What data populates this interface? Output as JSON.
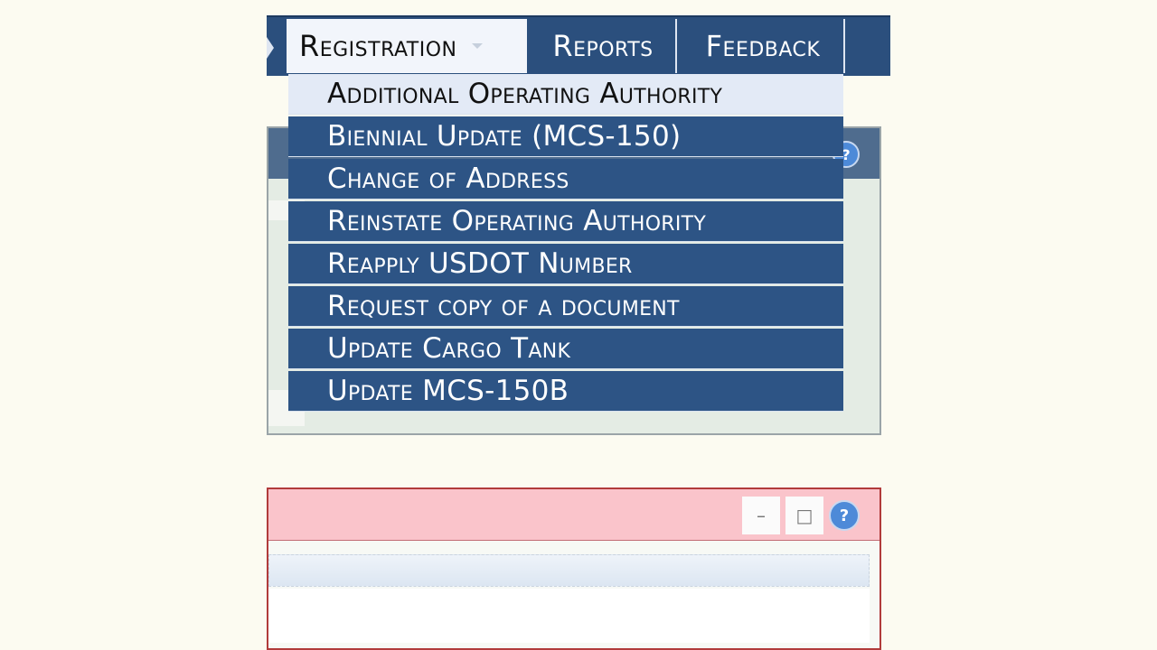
{
  "nav": {
    "tabs": [
      {
        "label": "Registration"
      },
      {
        "label": "Reports"
      },
      {
        "label": "Feedback"
      }
    ]
  },
  "dropdown": {
    "items": [
      {
        "label": "Additional Operating Authority"
      },
      {
        "label": "Biennial Update (MCS-150)"
      },
      {
        "label": "Change of Address"
      },
      {
        "label": "Reinstate Operating Authority"
      },
      {
        "label": "Reapply USDOT Number"
      },
      {
        "label": "Request copy of a document"
      },
      {
        "label": "Update Cargo Tank"
      },
      {
        "label": "Update MCS-150B"
      }
    ]
  },
  "panel": {
    "help_icon": "question-mark-icon"
  },
  "pink_panel": {
    "minimize_glyph": "–",
    "maximize_glyph": "□",
    "help_glyph": "?"
  },
  "colors": {
    "nav_bg": "#2b4f7d",
    "menu_bg": "#2d5485",
    "menu_hover_bg": "#e3eaf6",
    "pink_header": "#fac4cb",
    "page_bg": "#fcfbf1"
  }
}
